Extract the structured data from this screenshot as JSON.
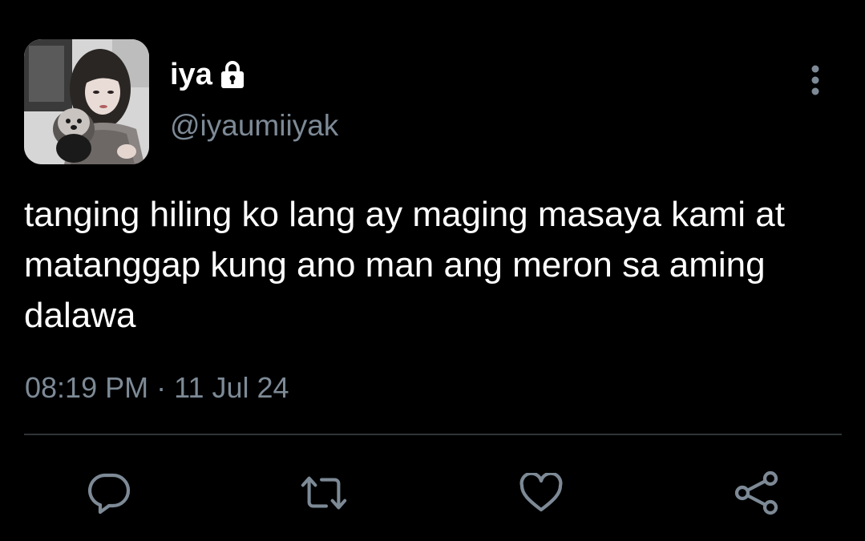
{
  "tweet": {
    "display_name": "iya",
    "handle": "@iyaumiiyak",
    "protected": true,
    "text": "tanging hiling ko lang ay maging masaya kami at matanggap kung ano man ang meron sa aming dalawa",
    "time": "08:19 PM",
    "separator": "·",
    "date": "11 Jul 24"
  },
  "actions": [
    {
      "icon": "reply-icon"
    },
    {
      "icon": "retweet-icon"
    },
    {
      "icon": "like-icon"
    },
    {
      "icon": "share-icon"
    }
  ],
  "colors": {
    "background": "#000000",
    "text": "#ffffff",
    "secondary_text": "#7d8a96",
    "divider": "#2f3336"
  }
}
